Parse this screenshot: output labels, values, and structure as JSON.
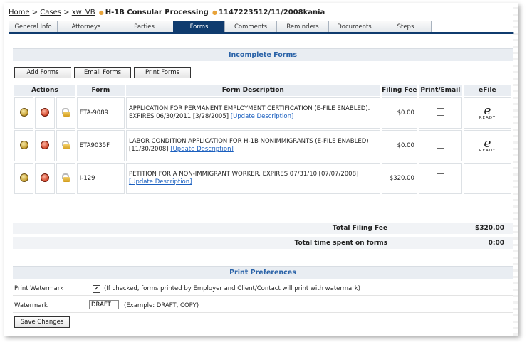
{
  "breadcrumb": {
    "home": "Home",
    "cases": "Cases",
    "case_link": "xw_VB",
    "case_type": "H-1B Consular Processing",
    "case_id": "1147223512/11/2008kania"
  },
  "tabs": [
    {
      "label": "General Info",
      "active": false
    },
    {
      "label": "Attorneys",
      "active": false
    },
    {
      "label": "Parties",
      "active": false
    },
    {
      "label": "Forms",
      "active": true
    },
    {
      "label": "Comments",
      "active": false
    },
    {
      "label": "Reminders",
      "active": false
    },
    {
      "label": "Documents",
      "active": false
    },
    {
      "label": "Steps",
      "active": false
    }
  ],
  "incomplete_forms": {
    "title": "Incomplete Forms",
    "buttons": {
      "add": "Add Forms",
      "email": "Email Forms",
      "print": "Print Forms"
    },
    "columns": {
      "actions": "Actions",
      "form": "Form",
      "description": "Form Description",
      "fee": "Filing Fee",
      "print_email": "Print/Email",
      "efile": "eFile"
    },
    "update_link": "[Update Description]",
    "efile_badge": {
      "glyph": "e",
      "text": "READY"
    },
    "rows": [
      {
        "form": "ETA-9089",
        "description": "APPLICATION FOR PERMANENT EMPLOYMENT CERTIFICATION (E-FILE ENABLED). EXPIRES 06/30/2011 [3/28/2005]",
        "fee": "$0.00",
        "efile_ready": true
      },
      {
        "form": "ETA9035F",
        "description": "LABOR CONDITION APPLICATION FOR H-1B NONIMMIGRANTS (E-FILE ENABLED) [11/30/2008]",
        "fee": "$0.00",
        "efile_ready": true
      },
      {
        "form": "I-129",
        "description": "PETITION FOR A NON-IMMIGRANT WORKER. EXPIRES 07/31/10 [07/07/2008]",
        "fee": "$320.00",
        "efile_ready": false
      }
    ]
  },
  "totals": {
    "filing_fee_label": "Total Filing Fee",
    "filing_fee_value": "$320.00",
    "time_label": "Total time spent on forms",
    "time_value": "0:00"
  },
  "print_preferences": {
    "title": "Print Preferences",
    "watermark_label": "Print Watermark",
    "watermark_checked": true,
    "watermark_note": "(If checked, forms printed by Employer and Client/Contact will print with watermark)",
    "text_label": "Watermark",
    "text_value": "DRAFT",
    "text_example": "(Example: DRAFT, COPY)",
    "save_button": "Save Changes"
  },
  "colors": {
    "tab_active": "#0f3b6e",
    "section_title": "#2b63a8",
    "link": "#1a5fbf"
  }
}
